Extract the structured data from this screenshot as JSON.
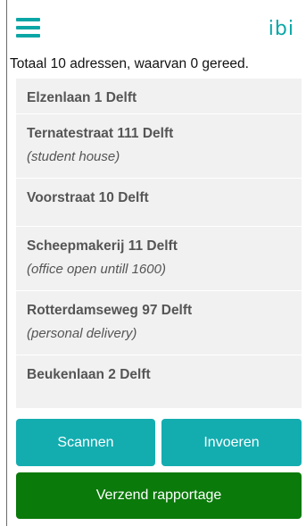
{
  "header": {
    "menu_icon": "hamburger-menu-icon",
    "logo_text": "ibi",
    "summary": "Totaal 10 adressen, waarvan 0 gereed."
  },
  "addresses": [
    {
      "address": "Elzenlaan 1 Delft",
      "note": ""
    },
    {
      "address": "Ternatestraat 111 Delft",
      "note": "(student house)"
    },
    {
      "address": "Voorstraat 10 Delft",
      "note": ""
    },
    {
      "address": "Scheepmakerij 11 Delft",
      "note": "(office open untill 1600)"
    },
    {
      "address": "Rotterdamseweg 97 Delft",
      "note": "(personal delivery)"
    },
    {
      "address": "Beukenlaan 2 Delft",
      "note": ""
    }
  ],
  "actions": {
    "scan_label": "Scannen",
    "input_label": "Invoeren",
    "send_label": "Verzend rapportage"
  },
  "colors": {
    "accent": "#0aa6a6",
    "button_teal": "#13adb0",
    "button_green": "#0a7a0a",
    "list_background": "#f1f1f1"
  }
}
